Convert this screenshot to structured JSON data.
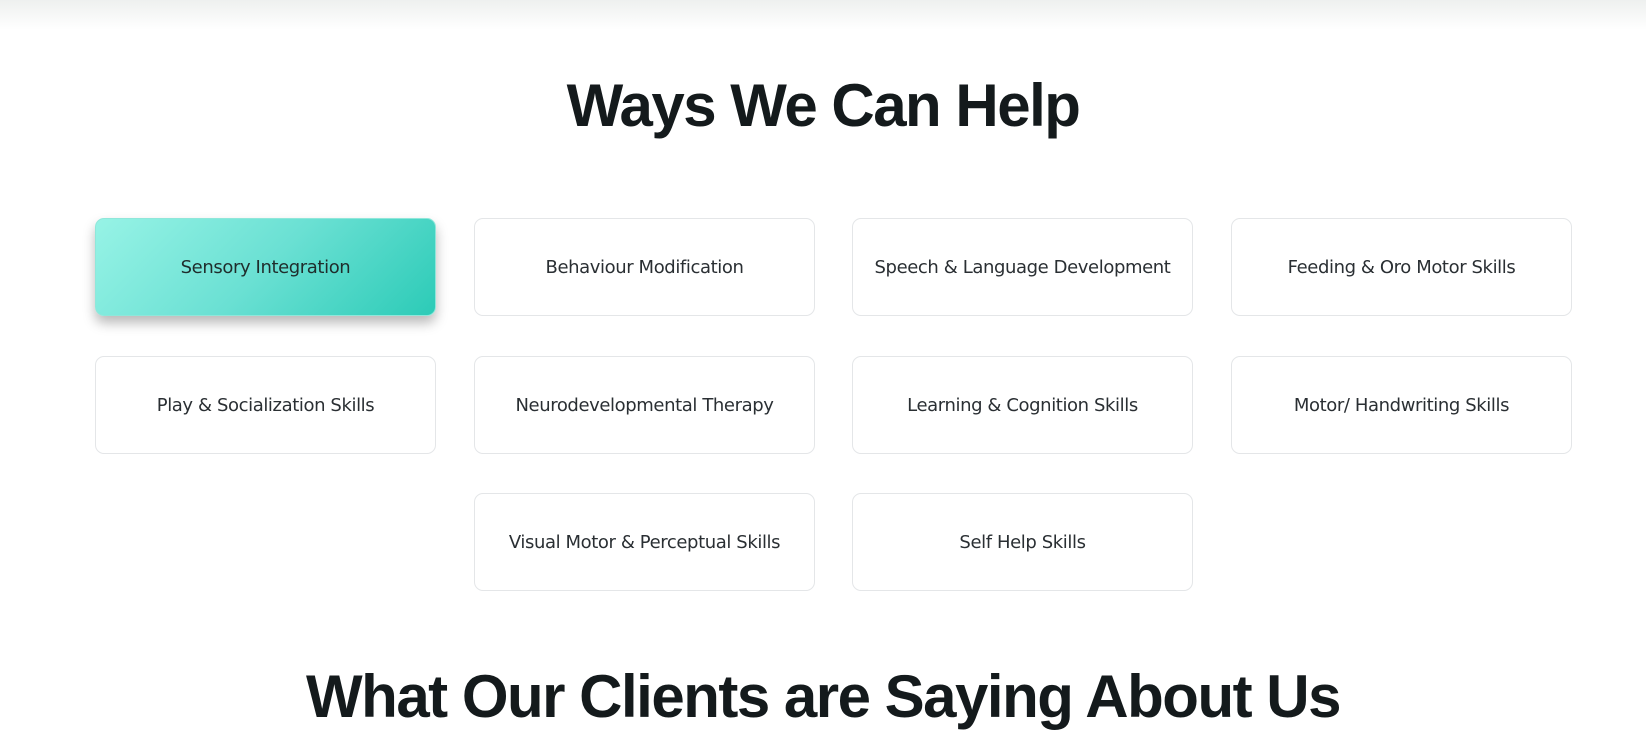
{
  "sections": {
    "help_title": "Ways We Can Help",
    "clients_title": "What Our Clients are Saying About Us"
  },
  "services": [
    {
      "label": "Sensory Integration",
      "active": true
    },
    {
      "label": "Behaviour Modification"
    },
    {
      "label": "Speech & Language Development"
    },
    {
      "label": "Feeding & Oro Motor Skills"
    },
    {
      "label": "Play & Socialization Skills"
    },
    {
      "label": "Neurodevelopmental Therapy"
    },
    {
      "label": "Learning & Cognition Skills"
    },
    {
      "label": "Motor/ Handwriting Skills"
    },
    {
      "label": "Visual Motor & Perceptual Skills"
    },
    {
      "label": "Self Help Skills"
    }
  ],
  "colors": {
    "heading": "#141a1c",
    "active_gradient_start": "#97f3e6",
    "active_gradient_end": "#2ccbb7",
    "card_border": "#e4e6e8"
  }
}
